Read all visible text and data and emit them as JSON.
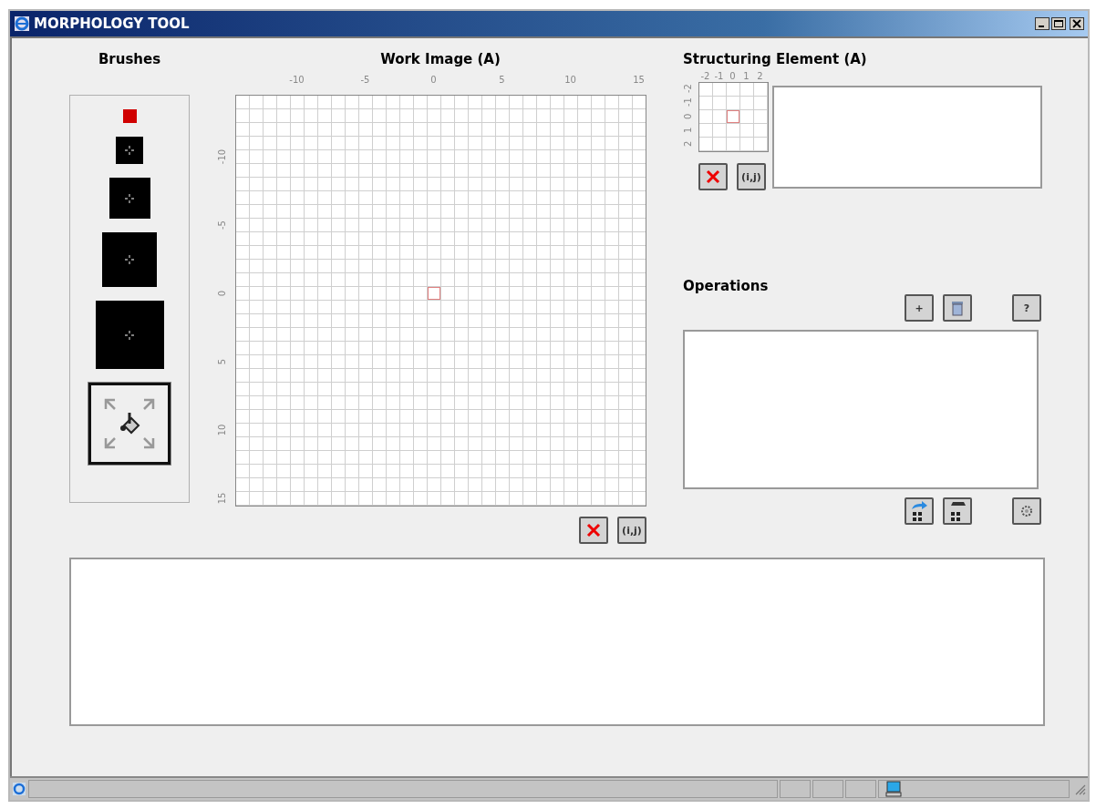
{
  "window": {
    "title": "MORPHOLOGY TOOL"
  },
  "brushes": {
    "title": "Brushes",
    "items": [
      {
        "kind": "dot",
        "selected": false
      },
      {
        "kind": "square",
        "selected": false
      },
      {
        "kind": "square",
        "selected": false
      },
      {
        "kind": "square",
        "selected": false
      },
      {
        "kind": "square",
        "selected": false
      },
      {
        "kind": "auto",
        "selected": true
      }
    ]
  },
  "work_image": {
    "title": "**Work Image** (A)",
    "x_ticks": [
      "-10",
      "-5",
      "0",
      "5",
      "10",
      "15"
    ],
    "y_ticks": [
      "-10",
      "-5",
      "0",
      "5",
      "10",
      "15"
    ],
    "buttons": [
      {
        "kind": "clear"
      },
      {
        "kind": "coords",
        "label": "(i,j)"
      }
    ]
  },
  "structuring_element": {
    "title": "**Structuring Element** (A)",
    "x_ticks": [
      "-2",
      "-1",
      "0",
      "1",
      "2"
    ],
    "y_ticks": [
      "-2",
      "-1",
      "0",
      "1",
      "2"
    ],
    "buttons": [
      {
        "kind": "clear"
      },
      {
        "kind": "coords",
        "label": "(i,j)"
      }
    ]
  },
  "operations": {
    "title": "Operations",
    "top_buttons": [
      {
        "kind": "add",
        "label": "+"
      },
      {
        "kind": "delete"
      },
      {
        "kind": "help",
        "label": "?"
      }
    ],
    "bottom_buttons": [
      {
        "kind": "load"
      },
      {
        "kind": "save"
      },
      {
        "kind": "settings"
      }
    ]
  }
}
